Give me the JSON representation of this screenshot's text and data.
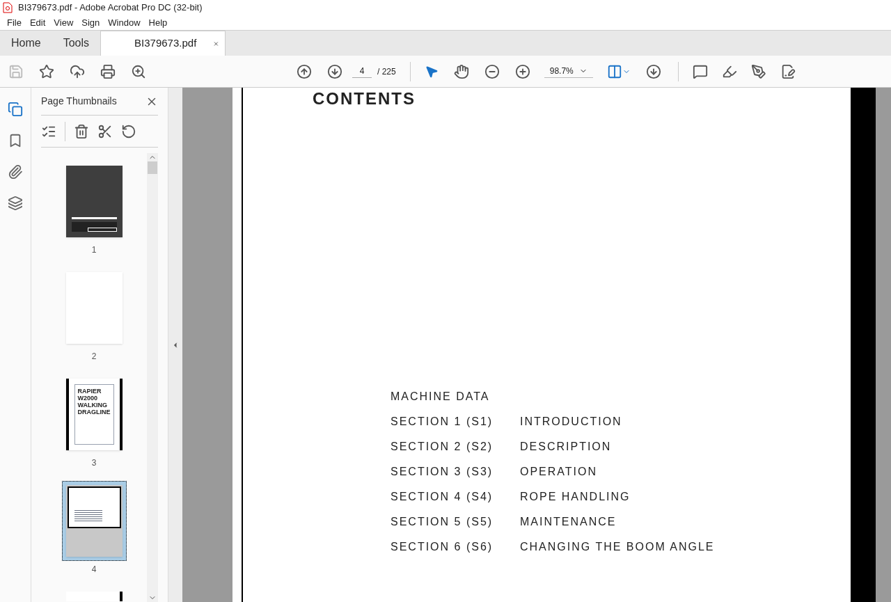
{
  "window": {
    "title": "BI379673.pdf - Adobe Acrobat Pro DC (32-bit)"
  },
  "menu": [
    "File",
    "Edit",
    "View",
    "Sign",
    "Window",
    "Help"
  ],
  "tabs": [
    {
      "label": "Home",
      "selected": false
    },
    {
      "label": "Tools",
      "selected": false
    },
    {
      "label": "BI379673.pdf",
      "selected": true,
      "closable": true
    }
  ],
  "toolbar": {
    "page": "4",
    "page_total": "/ 225",
    "zoom": "98.7%"
  },
  "side_rail": [
    {
      "kind": "pages",
      "selected": true
    },
    {
      "kind": "bookmark",
      "selected": false
    },
    {
      "kind": "attachment",
      "selected": false
    },
    {
      "kind": "layers",
      "selected": false
    }
  ],
  "panel": {
    "title": "Page Thumbnails",
    "thumbnails": [
      {
        "kind": "cover",
        "label": "1",
        "selected": false
      },
      {
        "kind": "blank",
        "label": "2",
        "selected": false
      },
      {
        "kind": "title",
        "label": "3",
        "selected": false,
        "heading": "RAPIER W2000 WALKING DRAGLINE"
      },
      {
        "kind": "contents",
        "label": "4",
        "selected": true
      },
      {
        "kind": "partial",
        "selected": false
      }
    ]
  },
  "document": {
    "heading": "CONTENTS",
    "entries": [
      {
        "section": "MACHINE DATA"
      },
      {
        "section": "SECTION 1 (S1)",
        "title": "INTRODUCTION"
      },
      {
        "section": "SECTION 2 (S2)",
        "title": "DESCRIPTION"
      },
      {
        "section": "SECTION 3 (S3)",
        "title": "OPERATION"
      },
      {
        "section": "SECTION 4 (S4)",
        "title": "ROPE HANDLING"
      },
      {
        "section": "SECTION 5 (S5)",
        "title": "MAINTENANCE"
      },
      {
        "section": "SECTION 6 (S6)",
        "title": "CHANGING THE BOOM ANGLE"
      }
    ]
  }
}
